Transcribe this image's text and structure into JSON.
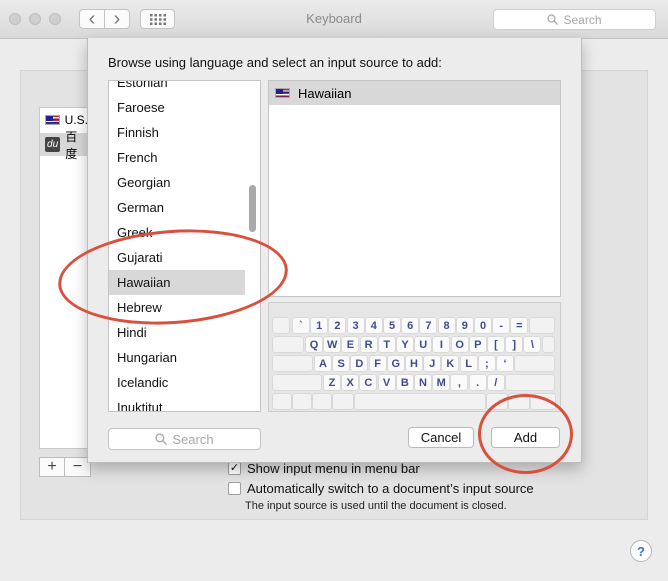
{
  "window": {
    "title": "Keyboard",
    "search_placeholder": "Search"
  },
  "toolbar": {
    "back_glyph": "‹",
    "forward_glyph": "›"
  },
  "background": {
    "sources": [
      {
        "label": "U.S.",
        "icon": "us-flag-icon"
      },
      {
        "label": "百度",
        "badge": "du",
        "icon": "baidu-icon"
      }
    ],
    "add_label": "+",
    "remove_label": "−",
    "show_menu_label": "Show input menu in menu bar",
    "show_menu_checked": true,
    "auto_switch_label": "Automatically switch to a document’s input source",
    "auto_switch_checked": false,
    "auto_switch_note": "The input source is used until the document is closed.",
    "help_label": "?"
  },
  "sheet": {
    "title": "Browse using language and select an input source to add:",
    "languages": [
      "Estonian",
      "Faroese",
      "Finnish",
      "French",
      "Georgian",
      "German",
      "Greek",
      "Gujarati",
      "Hawaiian",
      "Hebrew",
      "Hindi",
      "Hungarian",
      "Icelandic",
      "Inuktitut"
    ],
    "selected_language": "Hawaiian",
    "input_sources": [
      {
        "label": "Hawaiian",
        "icon": "hawaii-flag-icon"
      }
    ],
    "keyboard_rows": [
      [
        "`",
        "1",
        "2",
        "3",
        "4",
        "5",
        "6",
        "7",
        "8",
        "9",
        "0",
        "-",
        "="
      ],
      [
        "Q",
        "W",
        "E",
        "R",
        "T",
        "Y",
        "U",
        "I",
        "O",
        "P",
        "[",
        "]",
        "\\"
      ],
      [
        "A",
        "S",
        "D",
        "F",
        "G",
        "H",
        "J",
        "K",
        "L",
        ";",
        "‘"
      ],
      [
        "Z",
        "X",
        "C",
        "V",
        "B",
        "N",
        "M",
        ",",
        ".",
        "/"
      ]
    ],
    "search_placeholder": "Search",
    "cancel_label": "Cancel",
    "add_label": "Add"
  },
  "colors": {
    "annotation": "#d9503d",
    "key_text": "#3f4c91",
    "selection": "#d8d8d8"
  }
}
